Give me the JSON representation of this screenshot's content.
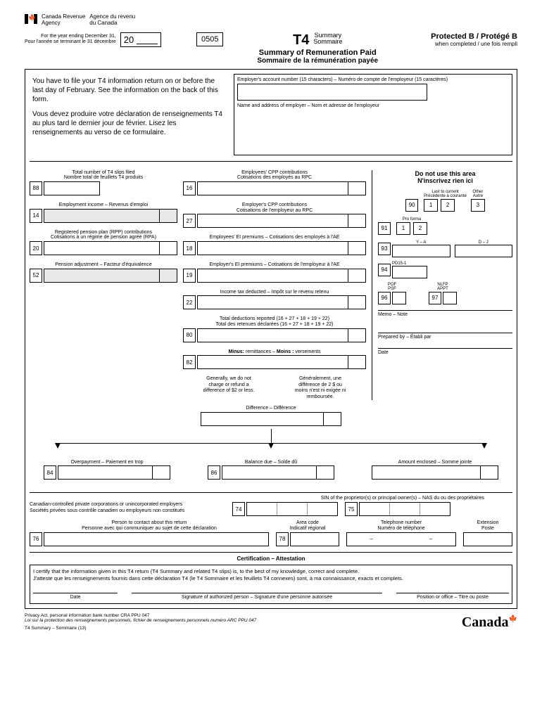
{
  "header": {
    "agency_en": "Canada Revenue",
    "agency_en2": "Agency",
    "agency_fr": "Agence du revenu",
    "agency_fr2": "du Canada",
    "year_text_en": "For the year ending December 31,",
    "year_text_fr": "Pour l'année se terminant le 31 décembre",
    "year_prefix": "20",
    "code": "0505",
    "form_code": "T4",
    "summary_en": "Summary",
    "summary_fr": "Sommaire",
    "title_en": "Summary of Remuneration Paid",
    "title_fr": "Sommaire de la rémunération payée",
    "protected": "Protected B / Protégé B",
    "protected_sub": "when completed / une fois rempli"
  },
  "instructions": {
    "en": "You have to file your T4 information return on or before the last day of February. See the information on the back of this form.",
    "fr": "Vous devez produire votre déclaration de renseignements T4 au plus tard le dernier jour de février. Lisez les renseignements au verso de ce formulaire."
  },
  "employer": {
    "account_label": "Employer's account number (15 characters) – Numéro de compte de l'employeur (15 caractères)",
    "name_label": "Name and address of employer – Nom et adresse de l'employeur"
  },
  "left_fields": [
    {
      "num": "88",
      "label": "Total number of T4 slips filed\nNombre total de feuillets T4 produits",
      "split": false
    },
    {
      "num": "14",
      "label": "Employment income – Revenus d'emploi",
      "split": true,
      "shaded": true
    },
    {
      "num": "20",
      "label": "Registered pension plan (RPP) contributions\nCotisations à un régime de pension agréé (RPA)",
      "split": true
    },
    {
      "num": "52",
      "label": "Pension adjustment – Facteur d'équivalence",
      "split": true,
      "shaded": true
    }
  ],
  "mid_fields": [
    {
      "num": "16",
      "label": "Employees' CPP contributions\nCotisations des employés au RPC",
      "split": true
    },
    {
      "num": "27",
      "label": "Employer's CPP contributions\nCotisations de l'employeur au RPC",
      "split": true
    },
    {
      "num": "18",
      "label": "Employees' EI premiums – Cotisations des employés à l'AE",
      "split": true
    },
    {
      "num": "19",
      "label": "Employer's EI premiums – Cotisations de l'employeur à l'AE",
      "split": true
    },
    {
      "num": "22",
      "label": "Income tax deducted – Impôt sur le revenu retenu",
      "split": true
    },
    {
      "num": "80",
      "label": "Total deductions reported  (16 + 27 + 18 + 19 + 22)\nTotal des retenues déclarées (16 + 27 + 18 + 19 + 22)",
      "split": true
    },
    {
      "num": "82",
      "label": "Minus: remittances – Moins : versements",
      "split": true,
      "bold_prefix": true
    }
  ],
  "notes": {
    "en": "Generally, we do not charge or refund a difference of $2 or less.",
    "fr": "Généralement, une différence de 2 $ ou moins n'est ni exigée ni remboursée."
  },
  "right": {
    "title_en": "Do not use this area",
    "title_fr": "N'inscrivez rien ici",
    "r90": "90",
    "r90_v1": "1",
    "r90_v2": "2",
    "r90_v3": "3",
    "r90_l1": "Last to current\nPrécédente à courante",
    "r90_l2": "Other\nAutre",
    "r91": "91",
    "r91_v1": "1",
    "r91_v2": "2",
    "r91_l": "Pro forma",
    "r93": "93",
    "r93_l1": "Y – A",
    "r93_l2": "D – J",
    "r94": "94",
    "r94_l": "PD15-1",
    "r96": "96",
    "r96_l": "POF\nPSF",
    "r97": "97",
    "r97_l": "NLFP\nAPPT",
    "memo": "Memo – Note",
    "prepared": "Prepared by – Établi par",
    "date": "Date"
  },
  "difference": {
    "label": "Difference – Différence"
  },
  "bottom_three": [
    {
      "num": "84",
      "label": "Overpayment – Paiement en trop"
    },
    {
      "num": "86",
      "label": "Balance due – Solde dû"
    },
    {
      "num": "",
      "label": "Amount enclosed – Somme jointe",
      "no_num": true
    }
  ],
  "sin": {
    "label": "SIN of the proprietor(s) or principal owner(s) – NAS du ou des propriétaires",
    "corp_label": "Canadian-controlled private corporations or unincorporated employers\nSociétés privées sous contrôle canadien ou employeurs non constitués",
    "b74": "74",
    "b75": "75"
  },
  "contact": {
    "person_label": "Person to contact about this return\nPersonne avec qui communiquer au sujet de cette déclaration",
    "b76": "76",
    "area_label": "Area code\nIndicatif régional",
    "b78": "78",
    "tel_label": "Telephone number\nNuméro de téléphone",
    "ext_label": "Extension\nPoste"
  },
  "cert": {
    "title": "Certification – Attestation",
    "text_en": "I certify that the information given in this T4 return (T4 Summary and related T4 slips) is, to the best of my knowledge, correct and complete.",
    "text_fr": "J'atteste que les renseignements fournis dans cette déclaration T4 (le T4 Sommaire et les feuillets T4 connexes) sont, à ma connaissance, exacts et complets.",
    "date": "Date",
    "sig": "Signature of authorized person – Signature d'une personne autorisée",
    "pos": "Position or office – Titre ou poste"
  },
  "footer": {
    "privacy_en": "Privacy Act, personal information bank number CRA PPU 047",
    "privacy_fr": "Loi sur la protection des renseignements personnels, fichier de renseignements personnels numéro ARC PPU 047",
    "form_id": "T4 Summary – Sommaire (13)",
    "canada": "Canada"
  }
}
